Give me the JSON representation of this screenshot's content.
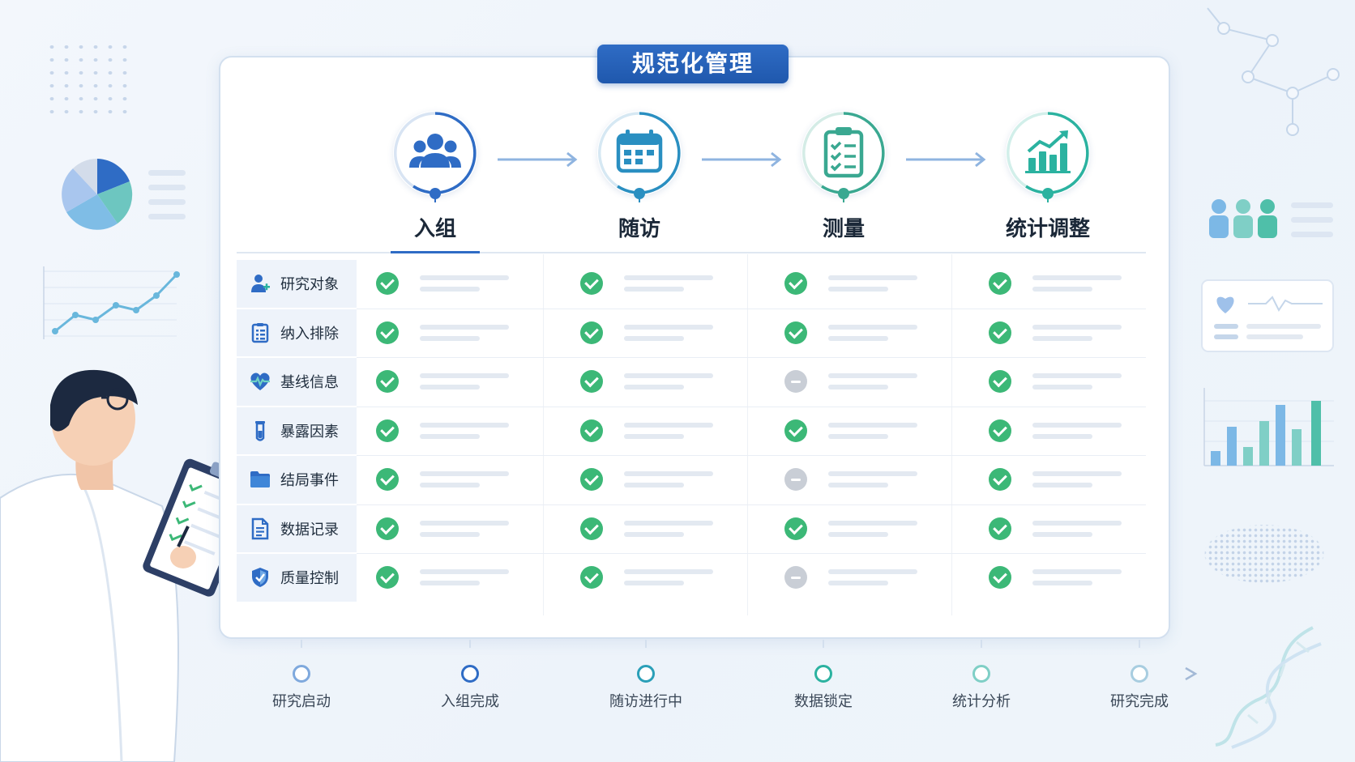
{
  "title": "规范化管理",
  "stages": [
    {
      "label": "入组",
      "icon": "group-icon",
      "color": "#2f6cc5"
    },
    {
      "label": "随访",
      "icon": "calendar-icon",
      "color": "#2a8fc1"
    },
    {
      "label": "测量",
      "icon": "clipboard-checklist-icon",
      "color": "#3aa891"
    },
    {
      "label": "统计调整",
      "icon": "bar-chart-trend-icon",
      "color": "#2bb2a0"
    }
  ],
  "rows": [
    {
      "label": "研究对象",
      "icon": "user-add-icon"
    },
    {
      "label": "纳入排除",
      "icon": "list-document-icon"
    },
    {
      "label": "基线信息",
      "icon": "heartbeat-icon"
    },
    {
      "label": "暴露因素",
      "icon": "test-tube-icon"
    },
    {
      "label": "结局事件",
      "icon": "folder-icon"
    },
    {
      "label": "数据记录",
      "icon": "document-icon"
    },
    {
      "label": "质量控制",
      "icon": "shield-check-icon"
    }
  ],
  "status_matrix": [
    [
      "check",
      "check",
      "check",
      "check"
    ],
    [
      "check",
      "check",
      "check",
      "check"
    ],
    [
      "check",
      "check",
      "minus",
      "check"
    ],
    [
      "check",
      "check",
      "check",
      "check"
    ],
    [
      "check",
      "check",
      "minus",
      "check"
    ],
    [
      "check",
      "check",
      "check",
      "check"
    ],
    [
      "check",
      "check",
      "minus",
      "check"
    ]
  ],
  "timeline": [
    {
      "label": "研究启动"
    },
    {
      "label": "入组完成"
    },
    {
      "label": "随访进行中"
    },
    {
      "label": "数据锁定"
    },
    {
      "label": "统计分析"
    },
    {
      "label": "研究完成"
    }
  ],
  "colors": {
    "primary": "#2f6cc5",
    "teal": "#2bb2a0",
    "check": "#3cb877",
    "na": "#c9ced6",
    "row_label_bg": "#eef3fa"
  }
}
